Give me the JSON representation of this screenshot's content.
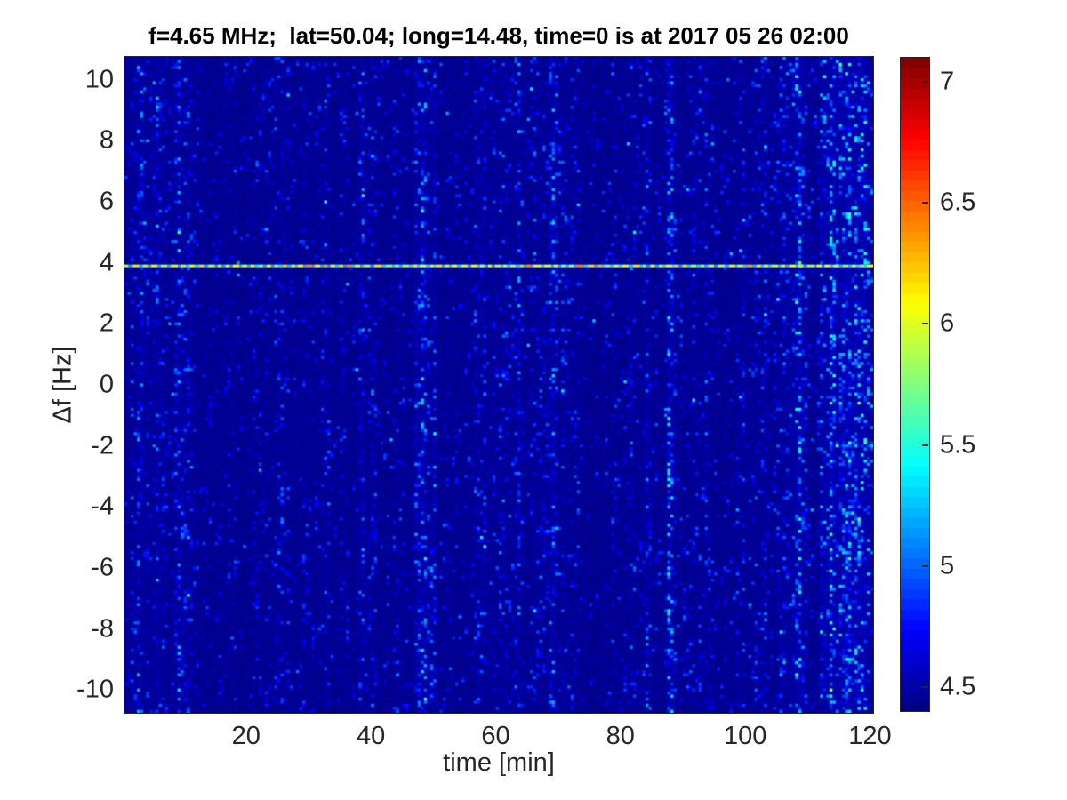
{
  "figure": {
    "background": "#ffffff",
    "axes_text_color": "#262626",
    "title_color": "#000000"
  },
  "chart_data": {
    "type": "heatmap",
    "title": "f=4.65 MHz;  lat=50.04; long=14.48, time=0 is at 2017 05 26 02:00",
    "xlabel": "time [min]",
    "ylabel": "Δf [Hz]",
    "xlim": [
      0.5,
      120.5
    ],
    "ylim": [
      -10.75,
      10.75
    ],
    "x_ticks": [
      20,
      40,
      60,
      80,
      100,
      120
    ],
    "y_ticks": [
      10,
      8,
      6,
      4,
      2,
      0,
      -2,
      -4,
      -6,
      -8,
      -10
    ],
    "grid": false,
    "legend": null,
    "colormap": "jet",
    "clim": [
      4.4,
      7.1
    ],
    "colorbar_ticks": [
      7,
      6.5,
      6,
      5.5,
      5,
      4.5
    ],
    "colorbar_levels": 64,
    "background_level": 4.43,
    "spectral_line": {
      "freq_hz": 3.9,
      "mean_level": 6.0,
      "level_jitter": 0.4,
      "gap_level": 5.15,
      "appearance": "bright dashed horizontal line spanning full time axis"
    },
    "noise": {
      "description": "speckled vertical noise streaks (blue to cyan) on dark navy background",
      "seed": 1337,
      "cols": 240,
      "rows": 215,
      "walk_step": 0.22,
      "density_min": 0.06,
      "density_max": 0.8,
      "speckle_base_level": 4.52,
      "speckle_max_boost": 0.35,
      "quiet_bands": [
        [
          13,
          16
        ],
        [
          41,
          47
        ],
        [
          50.5,
          56.5
        ],
        [
          74.5,
          77
        ],
        [
          85,
          87
        ],
        [
          110,
          112
        ]
      ],
      "quiet_factor": 0.22,
      "hot_columns": [
        3,
        6,
        9,
        11,
        18,
        21,
        24,
        27,
        30,
        33,
        36,
        38.5,
        48.5,
        58,
        61,
        63.5,
        66,
        69,
        71.5,
        79,
        81.5,
        84,
        88,
        91,
        94,
        97,
        100,
        103,
        106,
        108.5,
        114,
        116.5,
        119
      ],
      "hot_factor": 1.85
    }
  }
}
